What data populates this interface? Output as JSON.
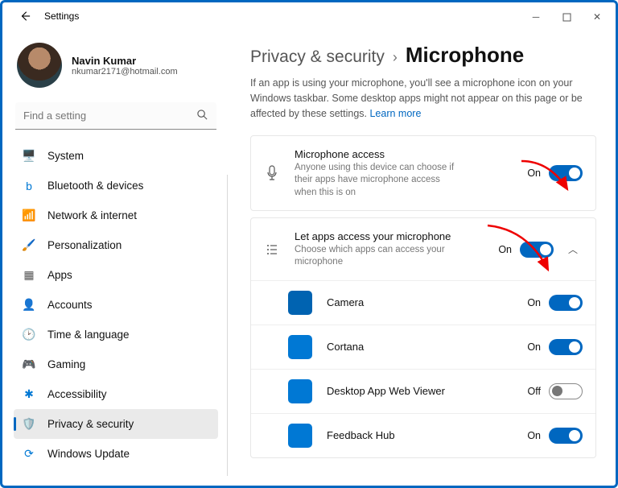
{
  "window": {
    "title": "Settings"
  },
  "user": {
    "name": "Navin Kumar",
    "email": "nkumar2171@hotmail.com"
  },
  "search": {
    "placeholder": "Find a setting"
  },
  "nav": [
    {
      "id": "system",
      "label": "System",
      "icon": "🖥️",
      "color": "#0078d4"
    },
    {
      "id": "bluetooth",
      "label": "Bluetooth & devices",
      "icon": "b",
      "color": "#0078d4"
    },
    {
      "id": "network",
      "label": "Network & internet",
      "icon": "📶",
      "color": "#00b0f0"
    },
    {
      "id": "personalization",
      "label": "Personalization",
      "icon": "🖌️",
      "color": "#d08030"
    },
    {
      "id": "apps",
      "label": "Apps",
      "icon": "▦",
      "color": "#555"
    },
    {
      "id": "accounts",
      "label": "Accounts",
      "icon": "👤",
      "color": "#3a8a3a"
    },
    {
      "id": "time",
      "label": "Time & language",
      "icon": "🕑",
      "color": "#555"
    },
    {
      "id": "gaming",
      "label": "Gaming",
      "icon": "🎮",
      "color": "#555"
    },
    {
      "id": "accessibility",
      "label": "Accessibility",
      "icon": "✱",
      "color": "#0078d4"
    },
    {
      "id": "privacy",
      "label": "Privacy & security",
      "icon": "🛡️",
      "color": "#888",
      "active": true
    },
    {
      "id": "update",
      "label": "Windows Update",
      "icon": "⟳",
      "color": "#0078d4"
    }
  ],
  "breadcrumb": {
    "parent": "Privacy & security",
    "current": "Microphone"
  },
  "description": {
    "text": "If an app is using your microphone, you'll see a microphone icon on your Windows taskbar. Some desktop apps might not appear on this page or be affected by these settings.  ",
    "link": "Learn more"
  },
  "micAccess": {
    "title": "Microphone access",
    "sub": "Anyone using this device can choose if their apps have microphone access when this is on",
    "state": "On",
    "on": true
  },
  "appsAccess": {
    "title": "Let apps access your microphone",
    "sub": "Choose which apps can access your microphone",
    "state": "On",
    "on": true
  },
  "apps": [
    {
      "name": "Camera",
      "state": "On",
      "on": true,
      "color": "#0063b1"
    },
    {
      "name": "Cortana",
      "state": "On",
      "on": true,
      "color": "#0078d4"
    },
    {
      "name": "Desktop App Web Viewer",
      "state": "Off",
      "on": false,
      "color": "#0078d4"
    },
    {
      "name": "Feedback Hub",
      "state": "On",
      "on": true,
      "color": "#0078d4"
    }
  ]
}
